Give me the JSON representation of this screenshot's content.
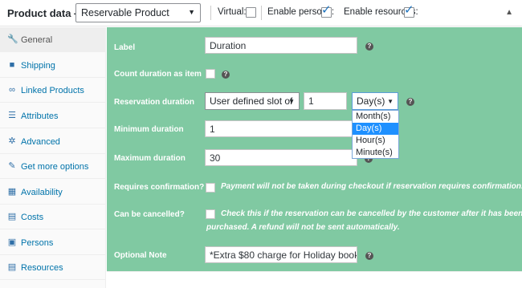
{
  "header": {
    "title": "Product data —",
    "product_type": "Reservable Product",
    "virtual_label": "Virtual:",
    "enable_persons_label": "Enable persons:",
    "enable_resources_label": "Enable resources:",
    "virtual_checked": false,
    "enable_persons_checked": true,
    "enable_resources_checked": true
  },
  "sidebar": {
    "items": [
      {
        "label": "General",
        "icon": "wrench-icon",
        "active": true
      },
      {
        "label": "Shipping",
        "icon": "truck-icon"
      },
      {
        "label": "Linked Products",
        "icon": "link-icon"
      },
      {
        "label": "Attributes",
        "icon": "list-icon"
      },
      {
        "label": "Advanced",
        "icon": "gear-icon"
      },
      {
        "label": "Get more options",
        "icon": "plugin-icon"
      },
      {
        "label": "Availability",
        "icon": "calendar-icon"
      },
      {
        "label": "Costs",
        "icon": "receipt-icon"
      },
      {
        "label": "Persons",
        "icon": "person-icon"
      },
      {
        "label": "Resources",
        "icon": "resources-icon"
      }
    ]
  },
  "form": {
    "label_label": "Label",
    "label_value": "Duration",
    "count_duration_label": "Count duration as item",
    "reservation_duration_label": "Reservation duration",
    "duration_type": "User defined slot of",
    "duration_amount": "1",
    "duration_unit": "Day(s)",
    "duration_unit_options": [
      "Month(s)",
      "Day(s)",
      "Hour(s)",
      "Minute(s)"
    ],
    "minimum_duration_label": "Minimum duration",
    "minimum_duration_value": "1",
    "maximum_duration_label": "Maximum duration",
    "maximum_duration_value": "30",
    "requires_confirmation_label": "Requires confirmation?",
    "requires_confirmation_desc": "Payment will not be taken during checkout if reservation requires confirmation.",
    "can_be_cancelled_label": "Can be cancelled?",
    "can_be_cancelled_desc_line1": "Check this if the reservation can be cancelled by the customer after it has been",
    "can_be_cancelled_desc_line2": "purchased. A refund will not be sent automatically.",
    "optional_note_label": "Optional Note",
    "optional_note_value": "*Extra $80 charge for Holiday bookin"
  },
  "colors": {
    "panel_bg": "#80c9a2",
    "link_blue": "#0073aa",
    "dropdown_highlight": "#1e90ff"
  }
}
